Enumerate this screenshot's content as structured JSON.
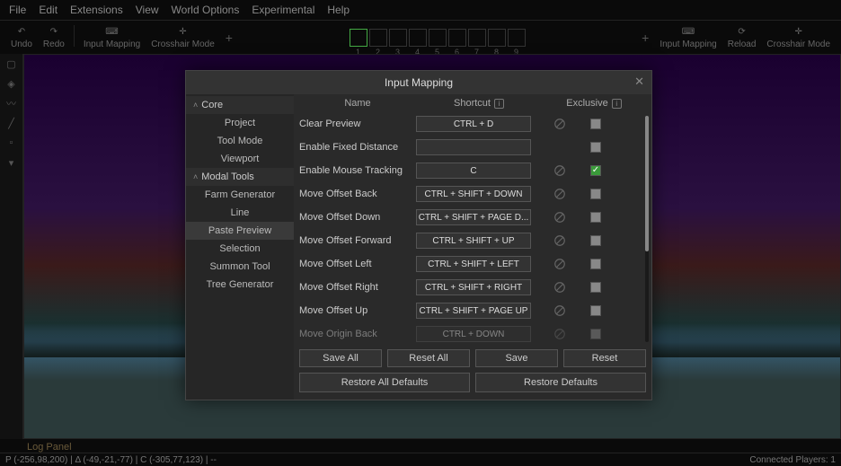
{
  "menubar": [
    "File",
    "Edit",
    "Extensions",
    "View",
    "World Options",
    "Experimental",
    "Help"
  ],
  "toolbar_left": [
    {
      "icon": "↶",
      "label": "Undo"
    },
    {
      "icon": "↷",
      "label": "Redo"
    },
    {
      "icon": "⌨",
      "label": "Input Mapping"
    },
    {
      "icon": "✛",
      "label": "Crosshair Mode"
    }
  ],
  "toolbar_right": [
    {
      "icon": "⌨",
      "label": "Input Mapping"
    },
    {
      "icon": "⟳",
      "label": "Reload"
    },
    {
      "icon": "✛",
      "label": "Crosshair Mode"
    }
  ],
  "hotbar_count": 9,
  "side_label": "Selection",
  "log_panel_label": "Log Panel",
  "status_left": "P (-256,98,200) | Δ (-49,-21,-77) | C (-305,77,123) | --",
  "status_right": "Connected Players: 1",
  "dialog": {
    "title": "Input Mapping",
    "columns": [
      "Name",
      "Shortcut",
      "Exclusive"
    ],
    "side_sections": [
      {
        "header": "Core",
        "items": [
          "Project",
          "Tool Mode",
          "Viewport"
        ]
      },
      {
        "header": "Modal Tools",
        "items": [
          "Farm Generator",
          "Line",
          "Paste Preview",
          "Selection",
          "Summon Tool",
          "Tree Generator"
        ],
        "selected": "Paste Preview"
      }
    ],
    "rows": [
      {
        "name": "Clear Preview",
        "shortcut": "CTRL + D",
        "disabled": true,
        "exclusive": false
      },
      {
        "name": "Enable Fixed Distance",
        "shortcut": "",
        "disabled": false,
        "exclusive": false
      },
      {
        "name": "Enable Mouse Tracking",
        "shortcut": "C",
        "disabled": true,
        "exclusive": true
      },
      {
        "name": "Move Offset Back",
        "shortcut": "CTRL + SHIFT + DOWN",
        "disabled": true,
        "exclusive": false
      },
      {
        "name": "Move Offset Down",
        "shortcut": "CTRL + SHIFT + PAGE D...",
        "disabled": true,
        "exclusive": false
      },
      {
        "name": "Move Offset Forward",
        "shortcut": "CTRL + SHIFT + UP",
        "disabled": true,
        "exclusive": false
      },
      {
        "name": "Move Offset Left",
        "shortcut": "CTRL + SHIFT + LEFT",
        "disabled": true,
        "exclusive": false
      },
      {
        "name": "Move Offset Right",
        "shortcut": "CTRL + SHIFT + RIGHT",
        "disabled": true,
        "exclusive": false
      },
      {
        "name": "Move Offset Up",
        "shortcut": "CTRL + SHIFT + PAGE UP",
        "disabled": true,
        "exclusive": false
      },
      {
        "name": "Move Origin Back",
        "shortcut": "CTRL + DOWN",
        "disabled": true,
        "exclusive": false
      }
    ],
    "buttons1": [
      "Save All",
      "Reset All",
      "Save",
      "Reset"
    ],
    "buttons2": [
      "Restore All Defaults",
      "Restore Defaults"
    ]
  }
}
